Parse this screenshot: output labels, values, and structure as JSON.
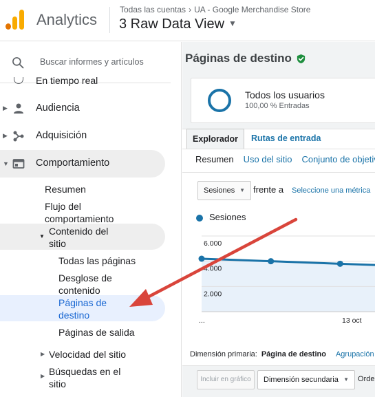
{
  "header": {
    "app_name": "Analytics",
    "crumb_account": "Todas las cuentas",
    "crumb_sep": "›",
    "crumb_property": "UA - Google Merchandise Store",
    "view_name": "3 Raw Data View"
  },
  "sidebar": {
    "search_placeholder": "Buscar informes y artículos",
    "cut_item": "En tiempo real",
    "items": [
      {
        "label": "Audiencia"
      },
      {
        "label": "Adquisición"
      },
      {
        "label": "Comportamiento"
      }
    ],
    "behavior_sub": {
      "summary": "Resumen",
      "flow_line1": "Flujo del",
      "flow_line2": "comportamiento",
      "content_line1": "Contenido del",
      "content_line2": "sitio",
      "all_pages": "Todas las páginas",
      "breakdown_line1": "Desglose de",
      "breakdown_line2": "contenido",
      "landing_line1": "Páginas de",
      "landing_line2": "destino",
      "exit_pages": "Páginas de salida",
      "speed": "Velocidad del sitio",
      "search_line1": "Búsquedas en el",
      "search_line2": "sitio"
    }
  },
  "main": {
    "title": "Páginas de destino",
    "segment_name": "Todos los usuarios",
    "segment_sub": "100,00 % Entradas",
    "tab_explorer": "Explorador",
    "tab_paths": "Rutas de entrada",
    "subtab_summary": "Resumen",
    "subtab_usage": "Uso del sitio",
    "subtab_goals": "Conjunto de objetivos",
    "metric_select": "Sesiones",
    "versus": "frente a",
    "pick_metric": "Seleccione una métrica",
    "legend": "Sesiones",
    "primary_dim_label": "Dimensión primaria:",
    "primary_dim_value": "Página de destino",
    "grouping": "Agrupación",
    "btn_plot": "Incluir en gráfico",
    "btn_secondary": "Dimensión secundaria",
    "btn_order": "Orden"
  },
  "chart_data": {
    "type": "line",
    "series": [
      {
        "name": "Sesiones",
        "values": [
          4200,
          4000,
          3800,
          3600
        ]
      }
    ],
    "x_tick_labels": [
      "...",
      "13 oct"
    ],
    "y_tick_labels": [
      "6.000",
      "4.000",
      "2.000"
    ],
    "ylim": [
      0,
      6000
    ],
    "grid": true,
    "color": "#1a73a8",
    "fill_color": "#e8f1fa"
  },
  "annotation": {
    "color": "#d9453b"
  }
}
